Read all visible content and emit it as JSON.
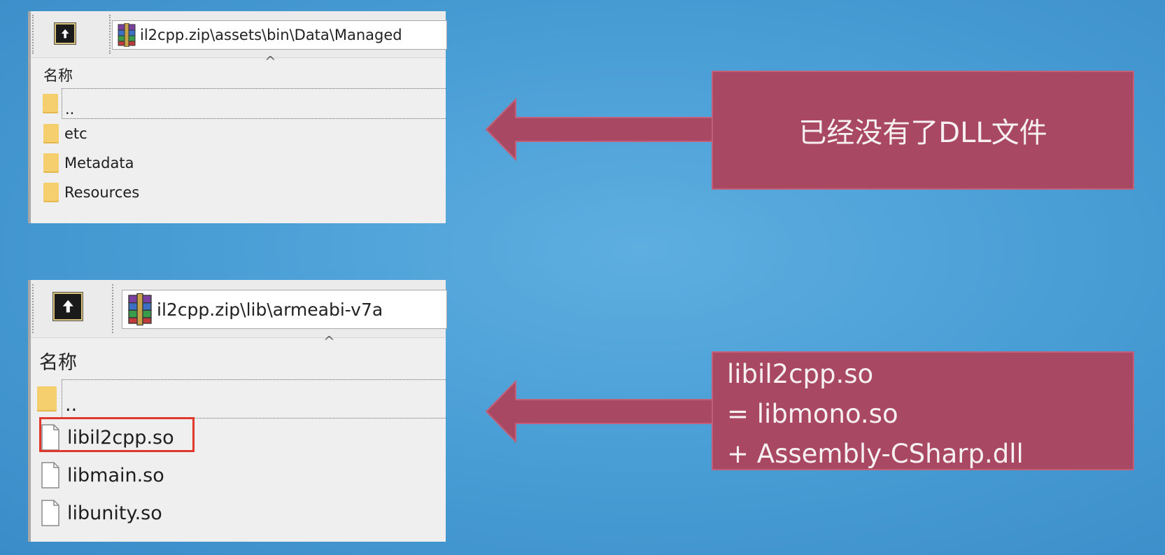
{
  "explorer_top": {
    "address_path": "il2cpp.zip\\assets\\bin\\Data\\Managed",
    "sort_indicator": "^",
    "column_header": "名称",
    "items": [
      {
        "name": "..",
        "type": "folder"
      },
      {
        "name": "etc",
        "type": "folder"
      },
      {
        "name": "Metadata",
        "type": "folder"
      },
      {
        "name": "Resources",
        "type": "folder"
      }
    ]
  },
  "explorer_bottom": {
    "address_path": "il2cpp.zip\\lib\\armeabi-v7a",
    "sort_indicator": "^",
    "column_header": "名称",
    "items": [
      {
        "name": "..",
        "type": "folder"
      },
      {
        "name": "libil2cpp.so",
        "type": "file",
        "highlighted": true
      },
      {
        "name": "libmain.so",
        "type": "file"
      },
      {
        "name": "libunity.so",
        "type": "file"
      }
    ]
  },
  "callout_top": {
    "text": "已经没有了DLL文件"
  },
  "callout_bottom": {
    "lines": [
      "libil2cpp.so",
      "= libmono.so",
      "+ Assembly-CSharp.dll"
    ]
  },
  "colors": {
    "background": "#4a9fd6",
    "callout_fill": "#a94862",
    "highlight_border": "#e0382c",
    "folder": "#f5cf6d"
  },
  "icons": {
    "up": "up-folder-icon",
    "archive": "winrar-archive-icon",
    "folder": "folder-icon",
    "file": "file-icon",
    "arrow": "left-arrow-icon"
  }
}
